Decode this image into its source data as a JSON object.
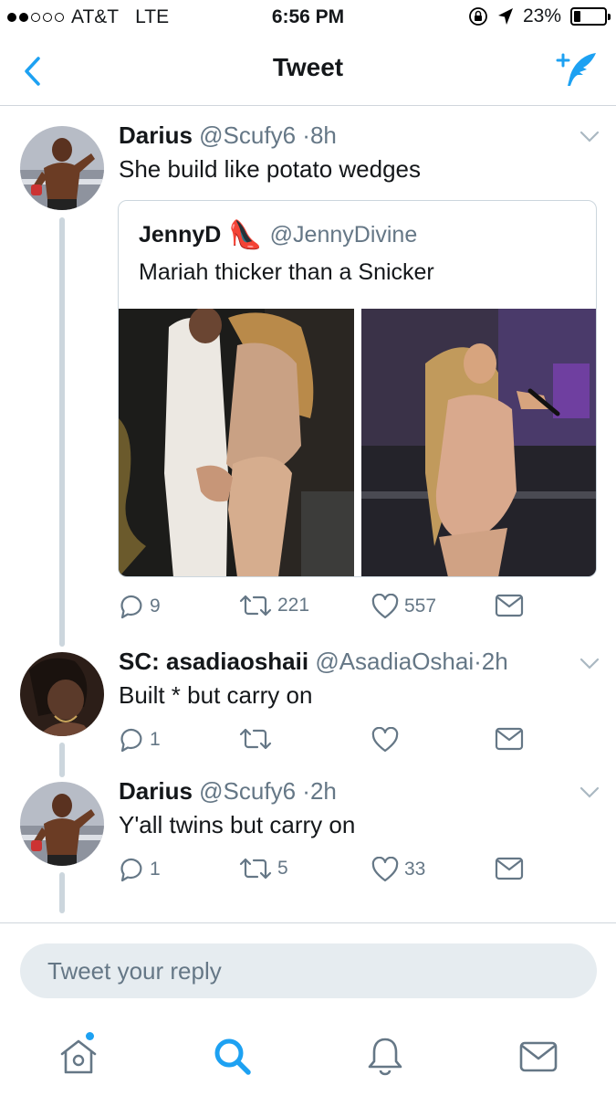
{
  "status_bar": {
    "carrier": "AT&T",
    "network": "LTE",
    "time": "6:56 PM",
    "battery": "23%",
    "battery_level": 0.23
  },
  "nav": {
    "title": "Tweet",
    "accent": "#1da1f2"
  },
  "tweets": [
    {
      "name": "Darius",
      "handle": "@Scufy6",
      "sep": "·",
      "time": "8h",
      "text": "She build like potato wedges",
      "quote": {
        "name": "JennyD",
        "emoji": "👠",
        "handle": "@JennyDivine",
        "text": "Mariah thicker than a Snicker"
      },
      "replies": "9",
      "retweets": "221",
      "likes": "557"
    },
    {
      "name": "SC: asadiaoshaii",
      "handle": "@AsadiaOshai",
      "sep": "·",
      "time": "2h",
      "text": "Built * but carry on",
      "replies": "1",
      "retweets": "",
      "likes": ""
    },
    {
      "name": "Darius",
      "handle": "@Scufy6",
      "sep": "·",
      "time": "2h",
      "text": "Y'all twins but carry on",
      "replies": "1",
      "retweets": "5",
      "likes": "33"
    }
  ],
  "reply": {
    "placeholder": "Tweet your reply"
  },
  "tabs": [
    "home-icon",
    "search-icon",
    "notifications-icon",
    "messages-icon"
  ]
}
